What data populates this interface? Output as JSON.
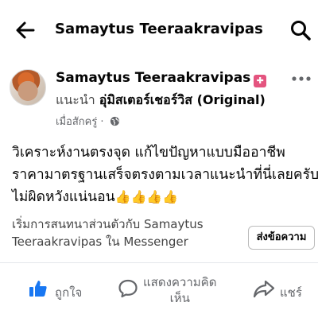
{
  "topbar": {
    "title": "Samaytus Teeraakravipas"
  },
  "post": {
    "author": "Samaytus Teeraakravipas",
    "badge": "✚",
    "intro_label": "แนะนำ",
    "intro_author": "อุ่มิสเตอร์เชอร์วิส (Original)",
    "timestamp": "เมื่อสักครู่ ·",
    "lines": [
      "วิเคราะห์งานตรงจุด แก้ไขปัญหาแบบมืออาชีพ",
      "ราคามาตรฐานเสร็จตรงตามเวลาแนะนำที่นี่เลยครับ",
      "ไม่ผิดหวังแน่นอน"
    ],
    "emojis": "👍👍👍👍"
  },
  "promo": {
    "line1": "เริ่มการสนทนาส่วนตัวกับ Samaytus",
    "line2": "Teeraakravipas ใน Messenger",
    "button": "ส่งข้อความ"
  },
  "actions": {
    "like": "ถูกใจ",
    "comment_line1": "แสดงความคิด",
    "comment_line2": "เห็น",
    "share": "แชร์"
  },
  "colors": {
    "like_blue": "#1877f2",
    "gray": "#65676b"
  }
}
